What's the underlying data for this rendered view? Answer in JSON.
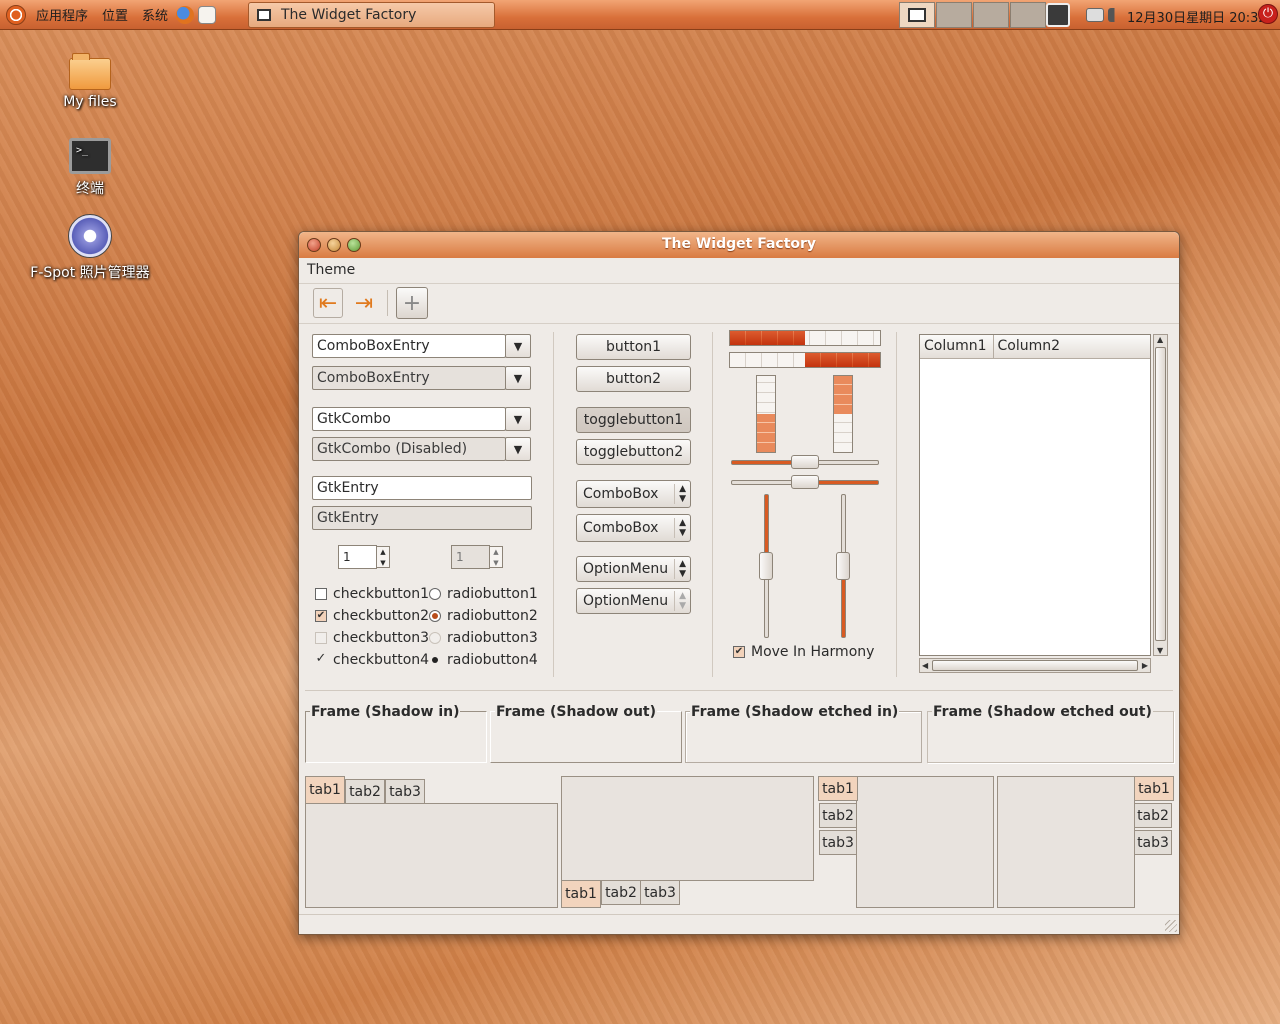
{
  "panel": {
    "menus": [
      "应用程序",
      "位置",
      "系统"
    ],
    "task_title": "The Widget Factory",
    "clock": "12月30日星期日 20:32",
    "workspace_count": 4
  },
  "desktop": {
    "icons": [
      {
        "label": "My files",
        "icon": "folder-icon"
      },
      {
        "label": "终端",
        "icon": "terminal-icon"
      },
      {
        "label": "F-Spot 照片管理器",
        "icon": "fspot-icon"
      }
    ]
  },
  "window": {
    "title": "The Widget Factory",
    "menu": [
      "Theme"
    ],
    "toolbar": [
      "go-back-icon",
      "go-forward-icon",
      "add-icon"
    ]
  },
  "entries": {
    "combo_entry_1": "ComboBoxEntry",
    "combo_entry_2": "ComboBoxEntry",
    "gtk_combo": "GtkCombo",
    "gtk_combo_disabled": "GtkCombo (Disabled)",
    "gtk_entry": "GtkEntry",
    "gtk_entry_disabled": "GtkEntry",
    "spin_1": "1",
    "spin_2": "1"
  },
  "checks": [
    {
      "label": "checkbutton1",
      "state": "unchecked"
    },
    {
      "label": "checkbutton2",
      "state": "checked"
    },
    {
      "label": "checkbutton3",
      "state": "insensitive"
    },
    {
      "label": "checkbutton4",
      "state": "checked-insensitive"
    }
  ],
  "radios": [
    {
      "label": "radiobutton1",
      "state": "unchecked"
    },
    {
      "label": "radiobutton2",
      "state": "checked"
    },
    {
      "label": "radiobutton3",
      "state": "insensitive"
    },
    {
      "label": "radiobutton4",
      "state": "checked-insensitive"
    }
  ],
  "buttons": {
    "button1": "button1",
    "button2": "button2",
    "toggle1": "togglebutton1",
    "toggle2": "togglebutton2",
    "combo1": "ComboBox",
    "combo2": "ComboBox",
    "option1": "OptionMenu",
    "option2": "OptionMenu"
  },
  "ranges": {
    "hprogress_1": 0.5,
    "hprogress_2": 0.5,
    "vprogress_1": 0.5,
    "vprogress_2": 0.5,
    "hscale_1": 0.5,
    "hscale_2": 0.5,
    "vscale_1": 0.5,
    "vscale_2": 0.5
  },
  "harmony": {
    "label": "Move In Harmony",
    "checked": true
  },
  "tree": {
    "columns": [
      "Column1",
      "Column2"
    ]
  },
  "frames": [
    "Frame (Shadow in)",
    "Frame (Shadow out)",
    "Frame (Shadow etched in)",
    "Frame (Shadow etched out)"
  ],
  "tabs": [
    "tab1",
    "tab2",
    "tab3"
  ],
  "colors": {
    "accent": "#d85a22",
    "panel": "#d9703a",
    "window_bg": "#efebe7"
  }
}
